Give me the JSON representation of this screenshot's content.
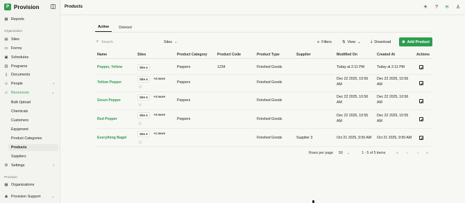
{
  "app": {
    "name": "Provision",
    "logo_letter": "P"
  },
  "topbar": {
    "title": "Products"
  },
  "sidebar": {
    "top_item": "Reports",
    "org_label": "Organization",
    "items": [
      "Sites",
      "Forms",
      "Schedules",
      "Programs",
      "Documents"
    ],
    "people": "People",
    "resources": "Resources",
    "resource_items": [
      "Bulk Upload",
      "Chemicals",
      "Customers",
      "Equipment",
      "Product Categories",
      "Products",
      "Suppliers"
    ],
    "settings": "Settings",
    "provision_label": "Provision",
    "organizations": "Organizations",
    "support": "Provision Support"
  },
  "tabs": [
    "Active",
    "Deleted"
  ],
  "toolbar": {
    "search_placeholder": "Search",
    "sites_filter": "Sites",
    "filters": "Filters",
    "view": "View",
    "download": "Download",
    "add_product": "Add Product"
  },
  "table": {
    "columns": [
      "Name",
      "Sites",
      "Product Category",
      "Product Code",
      "Product Type",
      "Supplier",
      "Modified On",
      "Created At",
      "Actions"
    ],
    "rows": [
      {
        "name": "Pepper, Yellow",
        "site": "Site 4",
        "more": "",
        "category": "Peppers",
        "code": "1234",
        "type": "Finished Goods",
        "supplier": "",
        "modified": "Today at 2:11 PM",
        "created": "Today at 2:11 PM"
      },
      {
        "name": "Yellow Pepper",
        "site": "Site 4",
        "more": "+3 more",
        "category": "Peppers",
        "code": "",
        "type": "Finished Goods",
        "supplier": "",
        "modified": "Dec 22 2025, 10:56 AM",
        "created": "Dec 22 2025, 10:56 AM"
      },
      {
        "name": "Green Pepper",
        "site": "Site 4",
        "more": "+3 more",
        "category": "Peppers",
        "code": "",
        "type": "Finished Goods",
        "supplier": "",
        "modified": "Dec 22 2025, 10:56 AM",
        "created": "Dec 22 2025, 10:56 AM"
      },
      {
        "name": "Red Pepper",
        "site": "Site 4",
        "more": "+3 more",
        "category": "Peppers",
        "code": "",
        "type": "Finished Goods",
        "supplier": "",
        "modified": "Dec 22 2025, 10:55 AM",
        "created": "Dec 22 2025, 10:55 AM"
      },
      {
        "name": "Everything Bagel",
        "site": "Site 2",
        "more": "+1 more",
        "category": "",
        "code": "",
        "type": "Finished Goods",
        "supplier": "Supplier 3",
        "modified": "Oct 21 2025, 9:50 AM",
        "created": "Oct 21 2025, 9:50 AM"
      }
    ]
  },
  "pagination": {
    "rows_label": "Rows per page",
    "rows_value": "50",
    "range": "1 - 5 of 5 items"
  },
  "colors": {
    "accent": "#2e9d4f"
  }
}
